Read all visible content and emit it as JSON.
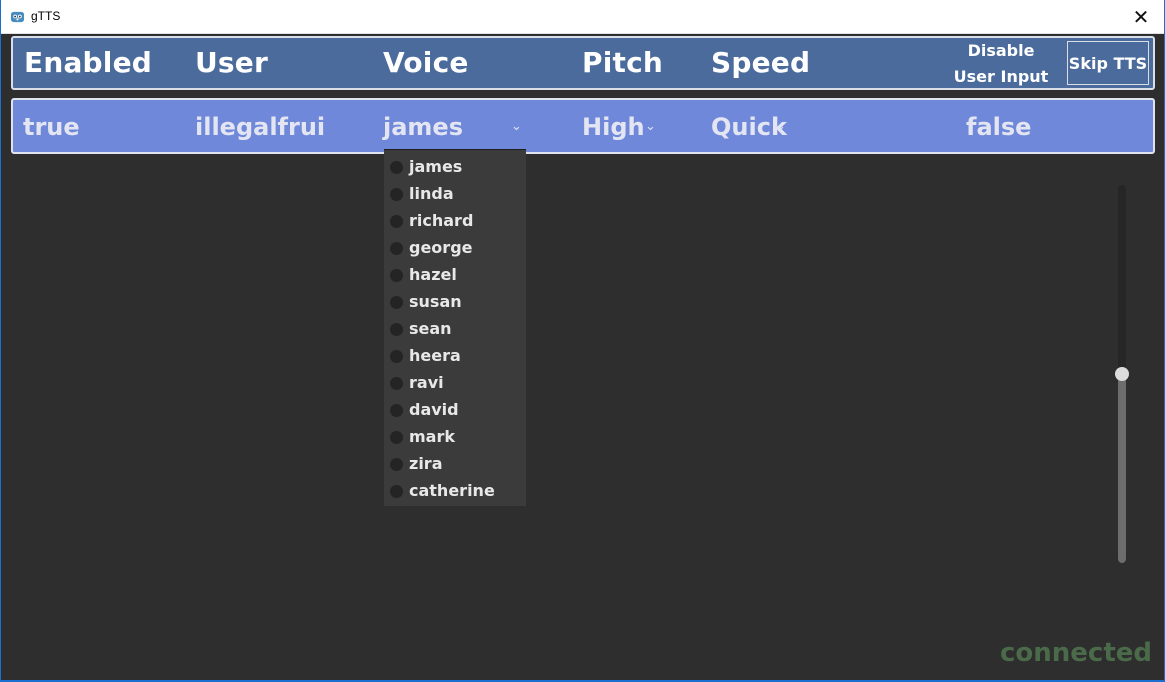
{
  "window": {
    "title": "gTTS",
    "close_glyph": "✕"
  },
  "header": {
    "enabled": "Enabled",
    "user": "User",
    "voice": "Voice",
    "pitch": "Pitch",
    "speed": "Speed",
    "disable_line1": "Disable",
    "disable_line2": "User Input",
    "skip_tts": "Skip TTS"
  },
  "row": {
    "enabled": "true",
    "user": "illegalfrui",
    "voice": "james",
    "pitch": "High",
    "speed": "Quick",
    "disable_input": "false",
    "chevron": "⌄"
  },
  "voice_options": [
    "james",
    "linda",
    "richard",
    "george",
    "hazel",
    "susan",
    "sean",
    "heera",
    "ravi",
    "david",
    "mark",
    "zira",
    "catherine"
  ],
  "volume_slider_level": 0.5,
  "status": "connected",
  "icons": {
    "app": "godot-icon",
    "close": "close-icon",
    "chevron": "chevron-down-icon",
    "radio": "radio-icon"
  },
  "colors": {
    "header_bg": "#4a6b9c",
    "row_bg": "#7088da",
    "body_bg": "#2e2e2e",
    "status": "#4a6a4a"
  }
}
